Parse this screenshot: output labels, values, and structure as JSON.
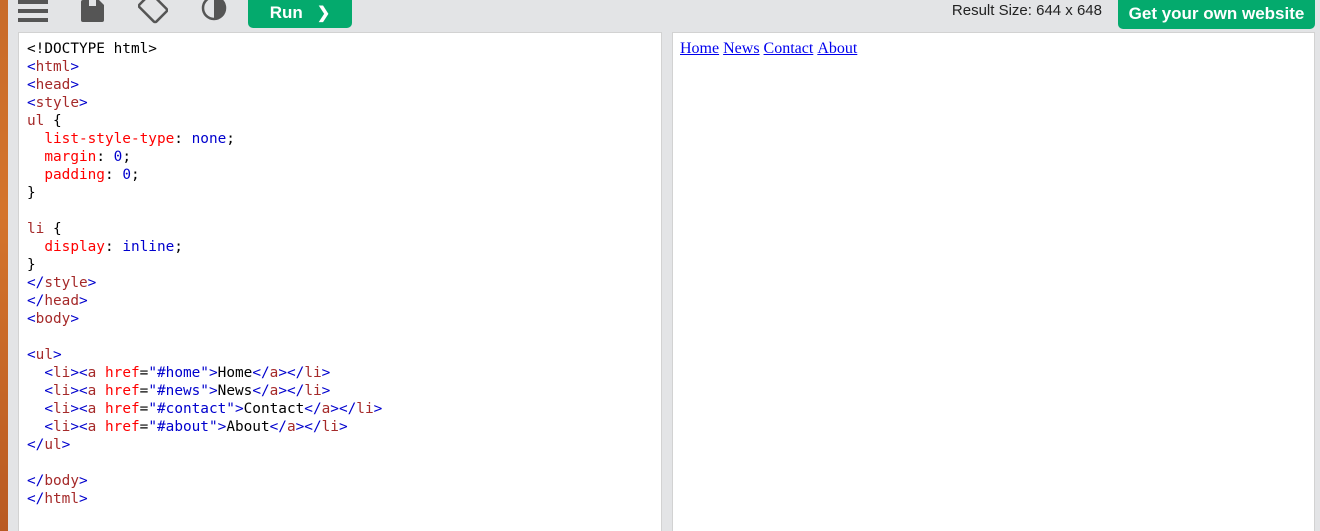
{
  "toolbar": {
    "run_label": "Run",
    "run_chevron": "❯",
    "result_size": "Result Size: 644 x 648",
    "get_website_label": "Get your own website",
    "icons": [
      "menu-icon",
      "save-icon",
      "rotate-icon",
      "theme-icon"
    ],
    "accent_color": "#04aa6d"
  },
  "code": [
    [
      [
        "t-doc",
        "<!DOCTYPE html>"
      ]
    ],
    [
      [
        "t-br",
        "<"
      ],
      [
        "t-tag",
        "html"
      ],
      [
        "t-br",
        ">"
      ]
    ],
    [
      [
        "t-br",
        "<"
      ],
      [
        "t-tag",
        "head"
      ],
      [
        "t-br",
        ">"
      ]
    ],
    [
      [
        "t-br",
        "<"
      ],
      [
        "t-tag",
        "style"
      ],
      [
        "t-br",
        ">"
      ]
    ],
    [
      [
        "t-sel",
        "ul"
      ],
      [
        "t-text",
        " {"
      ]
    ],
    [
      [
        "t-text",
        "  "
      ],
      [
        "t-prop",
        "list-style-type"
      ],
      [
        "t-text",
        ": "
      ],
      [
        "t-pval",
        "none"
      ],
      [
        "t-text",
        ";"
      ]
    ],
    [
      [
        "t-text",
        "  "
      ],
      [
        "t-prop",
        "margin"
      ],
      [
        "t-text",
        ": "
      ],
      [
        "t-pval",
        "0"
      ],
      [
        "t-text",
        ";"
      ]
    ],
    [
      [
        "t-text",
        "  "
      ],
      [
        "t-prop",
        "padding"
      ],
      [
        "t-text",
        ": "
      ],
      [
        "t-pval",
        "0"
      ],
      [
        "t-text",
        ";"
      ]
    ],
    [
      [
        "t-text",
        "}"
      ]
    ],
    [
      [
        "t-text",
        ""
      ]
    ],
    [
      [
        "t-sel",
        "li"
      ],
      [
        "t-text",
        " {"
      ]
    ],
    [
      [
        "t-text",
        "  "
      ],
      [
        "t-prop",
        "display"
      ],
      [
        "t-text",
        ": "
      ],
      [
        "t-pval",
        "inline"
      ],
      [
        "t-text",
        ";"
      ]
    ],
    [
      [
        "t-text",
        "}"
      ]
    ],
    [
      [
        "t-br",
        "</"
      ],
      [
        "t-tag",
        "style"
      ],
      [
        "t-br",
        ">"
      ]
    ],
    [
      [
        "t-br",
        "</"
      ],
      [
        "t-tag",
        "head"
      ],
      [
        "t-br",
        ">"
      ]
    ],
    [
      [
        "t-br",
        "<"
      ],
      [
        "t-tag",
        "body"
      ],
      [
        "t-br",
        ">"
      ]
    ],
    [
      [
        "t-text",
        ""
      ]
    ],
    [
      [
        "t-br",
        "<"
      ],
      [
        "t-tag",
        "ul"
      ],
      [
        "t-br",
        ">"
      ]
    ],
    [
      [
        "t-text",
        "  "
      ],
      [
        "t-br",
        "<"
      ],
      [
        "t-tag",
        "li"
      ],
      [
        "t-br",
        "><"
      ],
      [
        "t-tag",
        "a"
      ],
      [
        "t-text",
        " "
      ],
      [
        "t-attr",
        "href"
      ],
      [
        "t-text",
        "="
      ],
      [
        "t-val",
        "\"#home\""
      ],
      [
        "t-br",
        ">"
      ],
      [
        "t-text",
        "Home"
      ],
      [
        "t-br",
        "</"
      ],
      [
        "t-tag",
        "a"
      ],
      [
        "t-br",
        "></"
      ],
      [
        "t-tag",
        "li"
      ],
      [
        "t-br",
        ">"
      ]
    ],
    [
      [
        "t-text",
        "  "
      ],
      [
        "t-br",
        "<"
      ],
      [
        "t-tag",
        "li"
      ],
      [
        "t-br",
        "><"
      ],
      [
        "t-tag",
        "a"
      ],
      [
        "t-text",
        " "
      ],
      [
        "t-attr",
        "href"
      ],
      [
        "t-text",
        "="
      ],
      [
        "t-val",
        "\"#news\""
      ],
      [
        "t-br",
        ">"
      ],
      [
        "t-text",
        "News"
      ],
      [
        "t-br",
        "</"
      ],
      [
        "t-tag",
        "a"
      ],
      [
        "t-br",
        "></"
      ],
      [
        "t-tag",
        "li"
      ],
      [
        "t-br",
        ">"
      ]
    ],
    [
      [
        "t-text",
        "  "
      ],
      [
        "t-br",
        "<"
      ],
      [
        "t-tag",
        "li"
      ],
      [
        "t-br",
        "><"
      ],
      [
        "t-tag",
        "a"
      ],
      [
        "t-text",
        " "
      ],
      [
        "t-attr",
        "href"
      ],
      [
        "t-text",
        "="
      ],
      [
        "t-val",
        "\"#contact\""
      ],
      [
        "t-br",
        ">"
      ],
      [
        "t-text",
        "Contact"
      ],
      [
        "t-br",
        "</"
      ],
      [
        "t-tag",
        "a"
      ],
      [
        "t-br",
        "></"
      ],
      [
        "t-tag",
        "li"
      ],
      [
        "t-br",
        ">"
      ]
    ],
    [
      [
        "t-text",
        "  "
      ],
      [
        "t-br",
        "<"
      ],
      [
        "t-tag",
        "li"
      ],
      [
        "t-br",
        "><"
      ],
      [
        "t-tag",
        "a"
      ],
      [
        "t-text",
        " "
      ],
      [
        "t-attr",
        "href"
      ],
      [
        "t-text",
        "="
      ],
      [
        "t-val",
        "\"#about\""
      ],
      [
        "t-br",
        ">"
      ],
      [
        "t-text",
        "About"
      ],
      [
        "t-br",
        "</"
      ],
      [
        "t-tag",
        "a"
      ],
      [
        "t-br",
        "></"
      ],
      [
        "t-tag",
        "li"
      ],
      [
        "t-br",
        ">"
      ]
    ],
    [
      [
        "t-br",
        "</"
      ],
      [
        "t-tag",
        "ul"
      ],
      [
        "t-br",
        ">"
      ]
    ],
    [
      [
        "t-text",
        ""
      ]
    ],
    [
      [
        "t-br",
        "</"
      ],
      [
        "t-tag",
        "body"
      ],
      [
        "t-br",
        ">"
      ]
    ],
    [
      [
        "t-br",
        "</"
      ],
      [
        "t-tag",
        "html"
      ],
      [
        "t-br",
        ">"
      ]
    ]
  ],
  "result": {
    "links": [
      "Home",
      "News",
      "Contact",
      "About"
    ]
  }
}
